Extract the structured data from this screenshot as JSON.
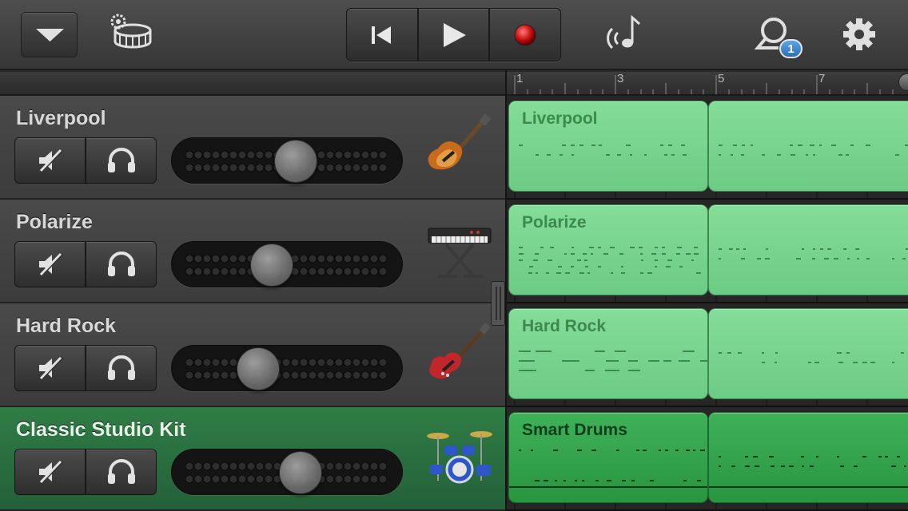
{
  "toolbar": {
    "dropdown_icon": "chevron-down-icon",
    "browser_icon": "drum-settings-icon",
    "transport": {
      "rewind_icon": "go-to-beginning-icon",
      "play_icon": "play-icon",
      "record_icon": "record-icon"
    },
    "smart_controls_icon": "smart-controls-icon",
    "loops_icon": "loop-icon",
    "loops_badge": "1",
    "settings_icon": "gear-icon"
  },
  "ruler": {
    "marks": [
      "1",
      "3",
      "5",
      "7"
    ]
  },
  "tracks": [
    {
      "name": "Liverpool",
      "region": "Liverpool",
      "volume": 0.55,
      "instrument": "bass-guitar-icon",
      "selected": false
    },
    {
      "name": "Polarize",
      "region": "Polarize",
      "volume": 0.4,
      "instrument": "keyboard-synth-icon",
      "selected": false
    },
    {
      "name": "Hard Rock",
      "region": "Hard Rock",
      "volume": 0.32,
      "instrument": "electric-guitar-icon",
      "selected": false
    },
    {
      "name": "Classic Studio Kit",
      "region": "Smart Drums",
      "volume": 0.58,
      "instrument": "drum-kit-icon",
      "selected": true
    }
  ],
  "colors": {
    "region_green": "#78d48e",
    "drum_region_green": "#35a650",
    "selected_track": "#2b7040",
    "record_red": "#d01818",
    "badge_blue": "#3d86cf"
  }
}
